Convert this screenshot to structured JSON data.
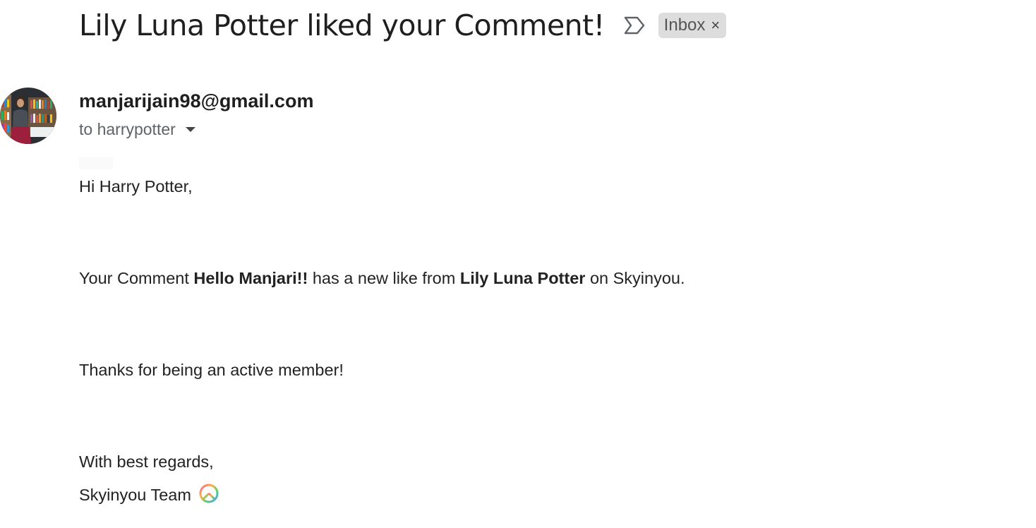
{
  "email": {
    "subject": "Lily Luna Potter liked your Comment!",
    "label": "Inbox",
    "label_close_glyph": "×",
    "importance_icon": "label-importance-icon",
    "sender": "manjarijain98@gmail.com",
    "recipient": "to harrypotter",
    "avatar_icon": "sender-avatar",
    "body": {
      "greeting": "Hi Harry Potter,",
      "line1_prefix": "Your Comment ",
      "line1_comment": "Hello Manjari!!",
      "line1_mid": " has a new like from ",
      "line1_user": "Lily Luna Potter",
      "line1_suffix": " on Skyinyou.",
      "thanks": "Thanks for being an active member!",
      "closing": "With best regards,",
      "signature": "Skyinyou Team",
      "signature_emoji": "peace-symbol-icon"
    }
  },
  "colors": {
    "label_bg": "#dddddd",
    "text_primary": "#1f1f1f",
    "text_secondary": "#5f6368"
  }
}
